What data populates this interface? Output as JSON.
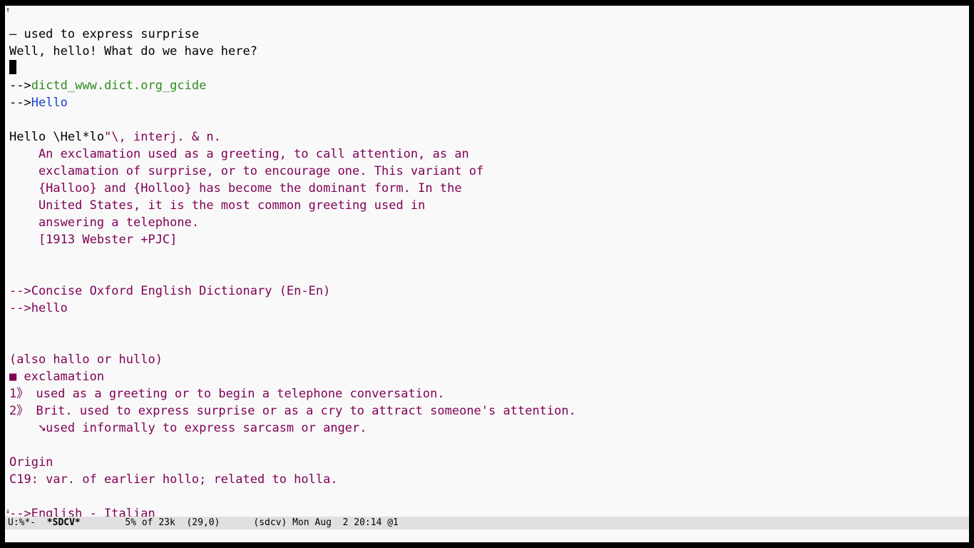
{
  "lines": {
    "l1": "— used to express surprise",
    "l2": "Well, hello! What do we have here?",
    "l4_prefix": "-->",
    "l4_source": "dictd_www.dict.org_gcide",
    "l5_prefix": "-->",
    "l5_word": "Hello",
    "l7a": "Hello \\Hel*lo",
    "l7b": "\"\\, interj. & n.",
    "l8": "    An exclamation used as a greeting, to call attention, as an",
    "l9": "    exclamation of surprise, or to encourage one. This variant of",
    "l10": "    {Halloo} and {Holloo} has become the dominant form. In the",
    "l11": "    United States, it is the most common greeting used in",
    "l12": "    answering a telephone.",
    "l13": "    [1913 Webster +PJC]",
    "l16": "-->Concise Oxford English Dictionary (En-En)",
    "l17": "-->hello",
    "l20": "(also hallo or hullo)",
    "l21": "■ exclamation",
    "l22": "1》 used as a greeting or to begin a telephone conversation.",
    "l23": "2》 Brit. used to express surprise or as a cry to attract someone's attention.",
    "l24": "    ➘used informally to express sarcasm or anger.",
    "l26": "Origin",
    "l27": "C19: var. of earlier hollo; related to holla.",
    "l29": "-->English - Italian"
  },
  "modeline": {
    "prefix": "U:%*-  ",
    "buffer": "*SDCV*",
    "rest": "        5% of 23k  (29,0)      (sdcv) Mon Aug  2 20:14 @1"
  },
  "chart_data": null
}
